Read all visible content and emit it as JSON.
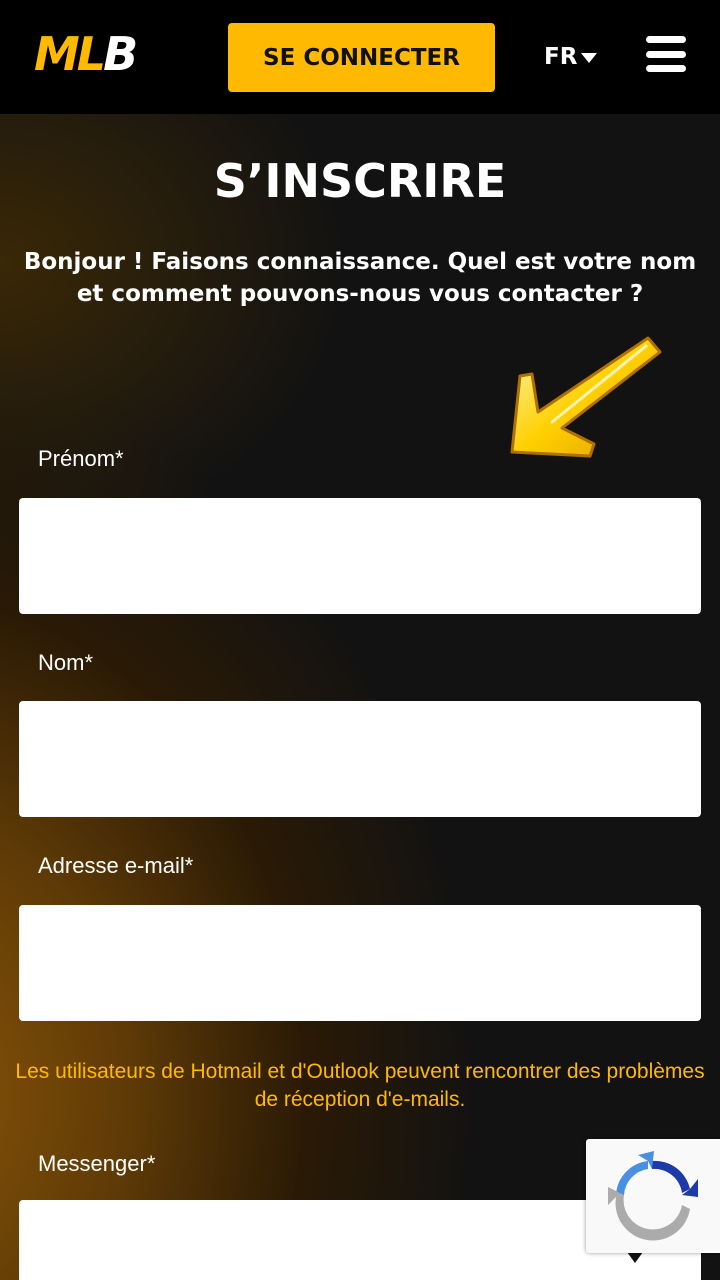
{
  "header": {
    "logo_part1": "ML",
    "logo_part2": "B",
    "login_label": "SE CONNECTER",
    "language": "FR"
  },
  "page": {
    "title": "S’INSCRIRE",
    "subtitle": "Bonjour ! Faisons connaissance. Quel est votre nom et comment pouvons-nous vous contacter ?"
  },
  "form": {
    "first_name_label": "Prénom*",
    "last_name_label": "Nom*",
    "email_label": "Adresse e-mail*",
    "email_notice": "Les utilisateurs de Hotmail et d'Outlook peuvent rencontrer des problèmes de réception d'e-mails.",
    "messenger_label": "Messenger*"
  },
  "colors": {
    "accent": "#ffba00",
    "header_bg": "#000000",
    "field_bg": "#ffffff"
  }
}
